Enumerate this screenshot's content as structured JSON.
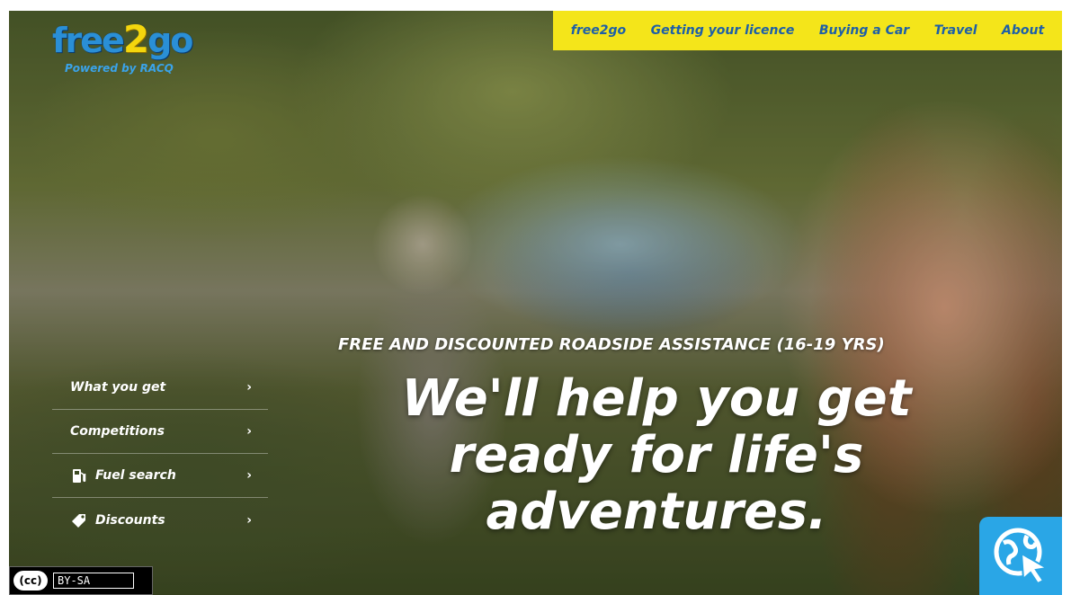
{
  "brand": {
    "logo_free": "free",
    "logo_two": "2",
    "logo_go": "go",
    "powered_by": "Powered by RACQ"
  },
  "topnav": {
    "items": [
      "free2go",
      "Getting your licence",
      "Buying a Car",
      "Travel",
      "About"
    ],
    "background": "#f4e51a",
    "text_color": "#1d5fa8"
  },
  "sidemenu": {
    "items": [
      {
        "label": "What you get",
        "icon": null
      },
      {
        "label": "Competitions",
        "icon": null
      },
      {
        "label": "Fuel search",
        "icon": "fuel-pump-icon"
      },
      {
        "label": "Discounts",
        "icon": "tag-icon"
      }
    ],
    "chevron": "›"
  },
  "hero": {
    "tagline": "FREE AND DISCOUNTED ROADSIDE ASSISTANCE (16-19 YRS)",
    "headline_line1": "We'll help you get",
    "headline_line2": "ready for life's",
    "headline_line3": "adventures."
  },
  "license": {
    "cc": "(cc)",
    "text": "BY-SA"
  },
  "assist": {
    "icon": "globe-cursor-icon",
    "color": "#2aa6e6"
  }
}
